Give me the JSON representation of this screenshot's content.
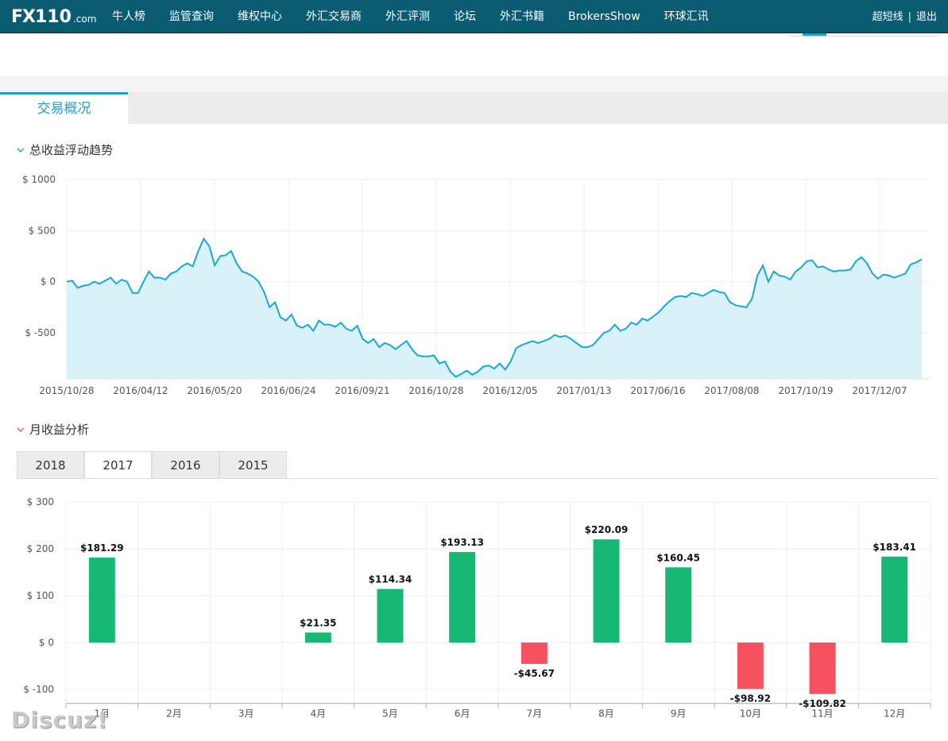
{
  "header": {
    "logo_fx": "FX",
    "logo_num": "110",
    "logo_com": ".com",
    "nav": [
      "牛人榜",
      "监管查询",
      "维权中心",
      "外汇交易商",
      "外汇评测",
      "论坛",
      "外汇书籍",
      "BrokersShow",
      "环球汇讯"
    ],
    "user_link": "超短线",
    "separator": "|",
    "logout": "退出"
  },
  "tabs": {
    "active": "交易概况"
  },
  "equity_section": {
    "title": "总收益浮动趋势"
  },
  "monthly_section": {
    "title": "月收益分析",
    "years": [
      "2018",
      "2017",
      "2016",
      "2015"
    ],
    "active_year": "2017"
  },
  "watermark": "Discuz!",
  "colors": {
    "nav_bg": "#0b5b72",
    "accent": "#1fa0c9",
    "line": "#1aa7d8",
    "area": "#d9f2fa",
    "positive": "#16b874",
    "negative": "#f5515f"
  },
  "chart_data": [
    {
      "type": "area",
      "y_ticks": [
        "$ 1000",
        "$ 500",
        "$ 0",
        "$ -500"
      ],
      "ylim": [
        -950,
        1000
      ],
      "x_ticks": [
        "2015/10/28",
        "2016/04/12",
        "2016/05/20",
        "2016/06/24",
        "2016/09/21",
        "2016/10/28",
        "2016/12/05",
        "2017/01/13",
        "2017/06/16",
        "2017/08/08",
        "2017/10/19",
        "2017/12/07"
      ],
      "values": [
        0,
        10,
        -60,
        -40,
        -30,
        0,
        -20,
        10,
        40,
        -20,
        20,
        0,
        -110,
        -110,
        0,
        100,
        40,
        40,
        20,
        80,
        100,
        150,
        180,
        150,
        300,
        420,
        350,
        160,
        250,
        260,
        300,
        180,
        100,
        80,
        50,
        0,
        -100,
        -250,
        -200,
        -350,
        -380,
        -320,
        -430,
        -450,
        -420,
        -480,
        -380,
        -420,
        -420,
        -440,
        -400,
        -460,
        -480,
        -430,
        -560,
        -600,
        -560,
        -640,
        -600,
        -620,
        -660,
        -620,
        -580,
        -660,
        -720,
        -730,
        -730,
        -720,
        -800,
        -780,
        -880,
        -930,
        -900,
        -870,
        -910,
        -880,
        -830,
        -820,
        -850,
        -800,
        -860,
        -780,
        -650,
        -620,
        -600,
        -580,
        -600,
        -580,
        -560,
        -520,
        -540,
        -530,
        -560,
        -600,
        -640,
        -640,
        -620,
        -560,
        -500,
        -480,
        -420,
        -480,
        -460,
        -400,
        -420,
        -360,
        -380,
        -340,
        -300,
        -240,
        -190,
        -150,
        -140,
        -150,
        -110,
        -120,
        -140,
        -110,
        -80,
        -100,
        -110,
        -200,
        -230,
        -240,
        -250,
        -170,
        60,
        160,
        0,
        100,
        60,
        50,
        20,
        100,
        140,
        200,
        210,
        140,
        150,
        120,
        100,
        110,
        110,
        120,
        200,
        240,
        180,
        80,
        30,
        70,
        60,
        40,
        60,
        80,
        170,
        190,
        220
      ]
    },
    {
      "type": "bar",
      "categories": [
        "1月",
        "2月",
        "3月",
        "4月",
        "5月",
        "6月",
        "7月",
        "8月",
        "9月",
        "10月",
        "11月",
        "12月"
      ],
      "values": [
        181.29,
        null,
        null,
        21.35,
        114.34,
        193.13,
        -45.67,
        220.09,
        160.45,
        -98.92,
        -109.82,
        183.41
      ],
      "labels": [
        "$181.29",
        "",
        "",
        "$21.35",
        "$114.34",
        "$193.13",
        "-$45.67",
        "$220.09",
        "$160.45",
        "-$98.92",
        "-$109.82",
        "$183.41"
      ],
      "y_ticks": [
        "$ 300",
        "$ 200",
        "$ 100",
        "$ 0",
        "$ -100"
      ],
      "ylim": [
        -130,
        300
      ]
    }
  ]
}
